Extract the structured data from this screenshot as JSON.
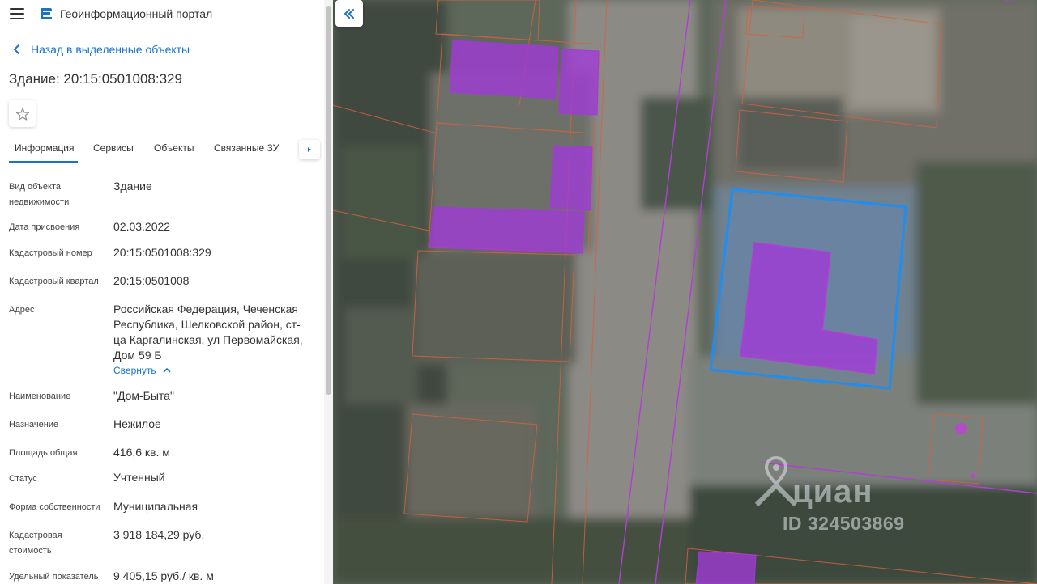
{
  "app": {
    "title": "Геоинформационный портал"
  },
  "nav": {
    "back_label": "Назад в выделенные объекты"
  },
  "object": {
    "title": "Здание: 20:15:0501008:329"
  },
  "tabs": [
    {
      "label": "Информация"
    },
    {
      "label": "Сервисы"
    },
    {
      "label": "Объекты"
    },
    {
      "label": "Связанные ЗУ"
    }
  ],
  "properties": [
    {
      "label": "Вид объекта недвижимости",
      "value": "Здание"
    },
    {
      "label": "Дата присвоения",
      "value": "02.03.2022"
    },
    {
      "label": "Кадастровый номер",
      "value": "20:15:0501008:329"
    },
    {
      "label": "Кадастровый квартал",
      "value": "20:15:0501008"
    },
    {
      "label": "Адрес",
      "value": "Российская Федерация, Чеченская Республика, Шелковской район, ст-ца Каргалинская, ул Первомайская, Дом 59 Б"
    },
    {
      "label": "Наименование",
      "value": "\"Дом-Быта\""
    },
    {
      "label": "Назначение",
      "value": "Нежилое"
    },
    {
      "label": "Площадь общая",
      "value": "416,6 кв. м"
    },
    {
      "label": "Статус",
      "value": "Учтенный"
    },
    {
      "label": "Форма собственности",
      "value": "Муниципальная"
    },
    {
      "label": "Кадастровая стоимость",
      "value": "3 918 184,29 руб."
    },
    {
      "label": "Удельный показатель",
      "value": "9 405,15 руб./ кв. м"
    }
  ],
  "address_collapse_label": "Свернуть",
  "watermark": {
    "brand": "циан",
    "id": "ID 324503869"
  },
  "colors": {
    "accent": "#1a73c8",
    "building_fill": "#a13ad8",
    "parcel_line": "#d4623f",
    "selection": "#1e8ef0",
    "zone_line": "#b23ed6"
  },
  "icons": {
    "menu": "hamburger-icon",
    "logo": "portal-logo-icon",
    "back": "chevron-left-icon",
    "favorite": "star-icon",
    "tabs_next": "chevron-right-icon",
    "collapse": "chevron-up-icon",
    "panel_collapse": "double-chevron-left-icon",
    "watermark_pin": "location-pin-icon"
  }
}
